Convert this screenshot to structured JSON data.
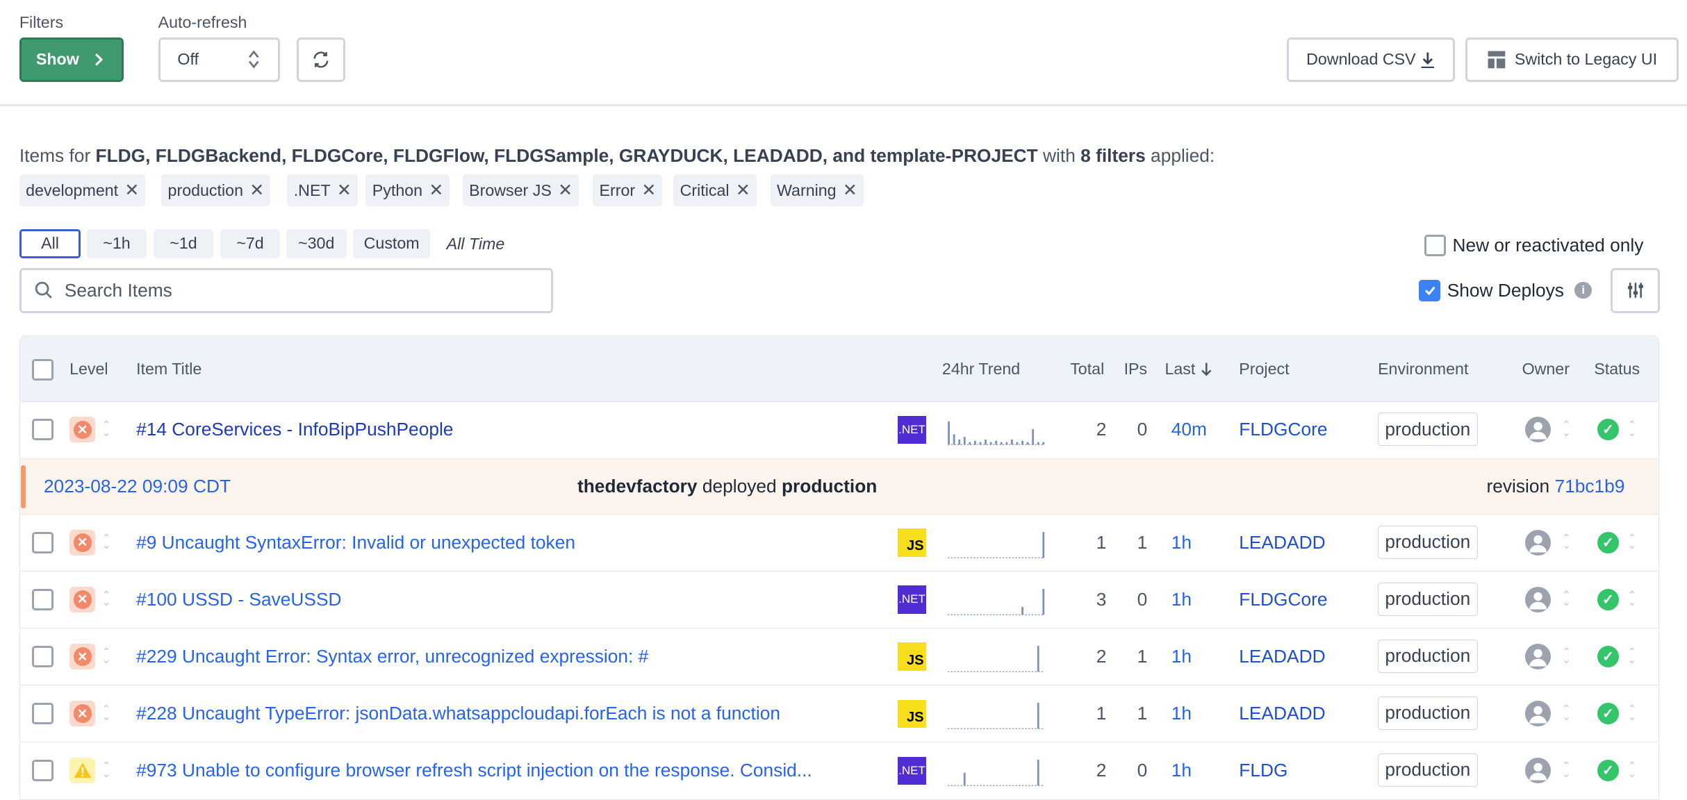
{
  "toolbar": {
    "filters_label": "Filters",
    "show_button": "Show",
    "autorefresh_label": "Auto-refresh",
    "autorefresh_value": "Off",
    "download_csv": "Download CSV",
    "legacy_ui": "Switch to Legacy UI"
  },
  "summary": {
    "prefix": "Items for ",
    "projects": "FLDG, FLDGBackend, FLDGCore, FLDGFlow, FLDGSample, GRAYDUCK, LEADADD, and template-PROJECT",
    "middle": " with ",
    "filters_count": "8 filters",
    "suffix": " applied:"
  },
  "chips": [
    {
      "label": "development"
    },
    {
      "label": "production"
    },
    {
      "label": ".NET"
    },
    {
      "label": "Python"
    },
    {
      "label": "Browser JS"
    },
    {
      "label": "Error"
    },
    {
      "label": "Critical"
    },
    {
      "label": "Warning"
    }
  ],
  "time_ranges": [
    {
      "label": "All",
      "active": true
    },
    {
      "label": "~1h"
    },
    {
      "label": "~1d"
    },
    {
      "label": "~7d"
    },
    {
      "label": "~30d"
    },
    {
      "label": "Custom"
    }
  ],
  "time_current": "All Time",
  "new_only_label": "New or reactivated only",
  "new_only_checked": false,
  "show_deploys_label": "Show Deploys",
  "show_deploys_checked": true,
  "search": {
    "placeholder": "Search Items"
  },
  "table": {
    "headers": {
      "level": "Level",
      "title": "Item Title",
      "trend": "24hr Trend",
      "total": "Total",
      "ips": "IPs",
      "last": "Last",
      "project": "Project",
      "environment": "Environment",
      "owner": "Owner",
      "status": "Status"
    },
    "rows": [
      {
        "kind": "item",
        "level": "error",
        "title": "#14 CoreServices - InfoBipPushPeople",
        "title_dark": true,
        "platform": ".NET",
        "total": "2",
        "ips": "0",
        "last": "40m",
        "project": "FLDGCore",
        "environment": "production",
        "trend": [
          0.9,
          0.4,
          0.2,
          0.3,
          0.1,
          0.15,
          0.1,
          0.2,
          0.1,
          0.15,
          0.1,
          0.1,
          0.2,
          0.1,
          0.15,
          0.1,
          0.6,
          0.1,
          0.1
        ]
      },
      {
        "kind": "deploy",
        "date": "2023-08-22 09:09 CDT",
        "user": "thedevfactory",
        "verb": " deployed ",
        "env": "production",
        "revision_label": "revision ",
        "revision": "71bc1b9"
      },
      {
        "kind": "item",
        "level": "error",
        "title": "#9 Uncaught SyntaxError: Invalid or unexpected token",
        "platform": "JS",
        "total": "1",
        "ips": "1",
        "last": "1h",
        "project": "LEADADD",
        "environment": "production",
        "trend": [
          0,
          0,
          0,
          0,
          0,
          0,
          0,
          0,
          0,
          0,
          0,
          0,
          0,
          0,
          0,
          0,
          0,
          0,
          1.0
        ]
      },
      {
        "kind": "item",
        "level": "error",
        "title": "#100 USSD - SaveUSSD",
        "platform": ".NET",
        "total": "3",
        "ips": "0",
        "last": "1h",
        "project": "FLDGCore",
        "environment": "production",
        "trend": [
          0,
          0,
          0,
          0,
          0,
          0,
          0,
          0,
          0,
          0,
          0,
          0,
          0,
          0,
          0.3,
          0,
          0,
          0,
          1.0
        ]
      },
      {
        "kind": "item",
        "level": "error",
        "title": "#229 Uncaught Error: Syntax error, unrecognized expression: #",
        "platform": "JS",
        "total": "2",
        "ips": "1",
        "last": "1h",
        "project": "LEADADD",
        "environment": "production",
        "trend": [
          0,
          0,
          0,
          0,
          0,
          0,
          0,
          0,
          0,
          0,
          0,
          0,
          0,
          0,
          0,
          0,
          0,
          1.0,
          0
        ]
      },
      {
        "kind": "item",
        "level": "error",
        "title": "#228 Uncaught TypeError: jsonData.whatsappcloudapi.forEach is not a function",
        "platform": "JS",
        "total": "1",
        "ips": "1",
        "last": "1h",
        "project": "LEADADD",
        "environment": "production",
        "trend": [
          0,
          0,
          0,
          0,
          0,
          0,
          0,
          0,
          0,
          0,
          0,
          0,
          0,
          0,
          0,
          0,
          0,
          1.0,
          0
        ]
      },
      {
        "kind": "item",
        "level": "warning",
        "title": "#973 Unable to configure browser refresh script injection on the response. Consid...",
        "platform": ".NET",
        "total": "2",
        "ips": "0",
        "last": "1h",
        "project": "FLDG",
        "environment": "production",
        "trend": [
          0,
          0,
          0,
          0.5,
          0,
          0,
          0,
          0,
          0,
          0,
          0,
          0,
          0,
          0,
          0,
          0,
          0,
          1.0,
          0
        ]
      }
    ]
  },
  "colors": {
    "accent": "#3f9a6f",
    "link": "#2563eb",
    "net": "#512bd4",
    "js": "#f7df1e",
    "deploy_bar": "#f39b6d"
  }
}
